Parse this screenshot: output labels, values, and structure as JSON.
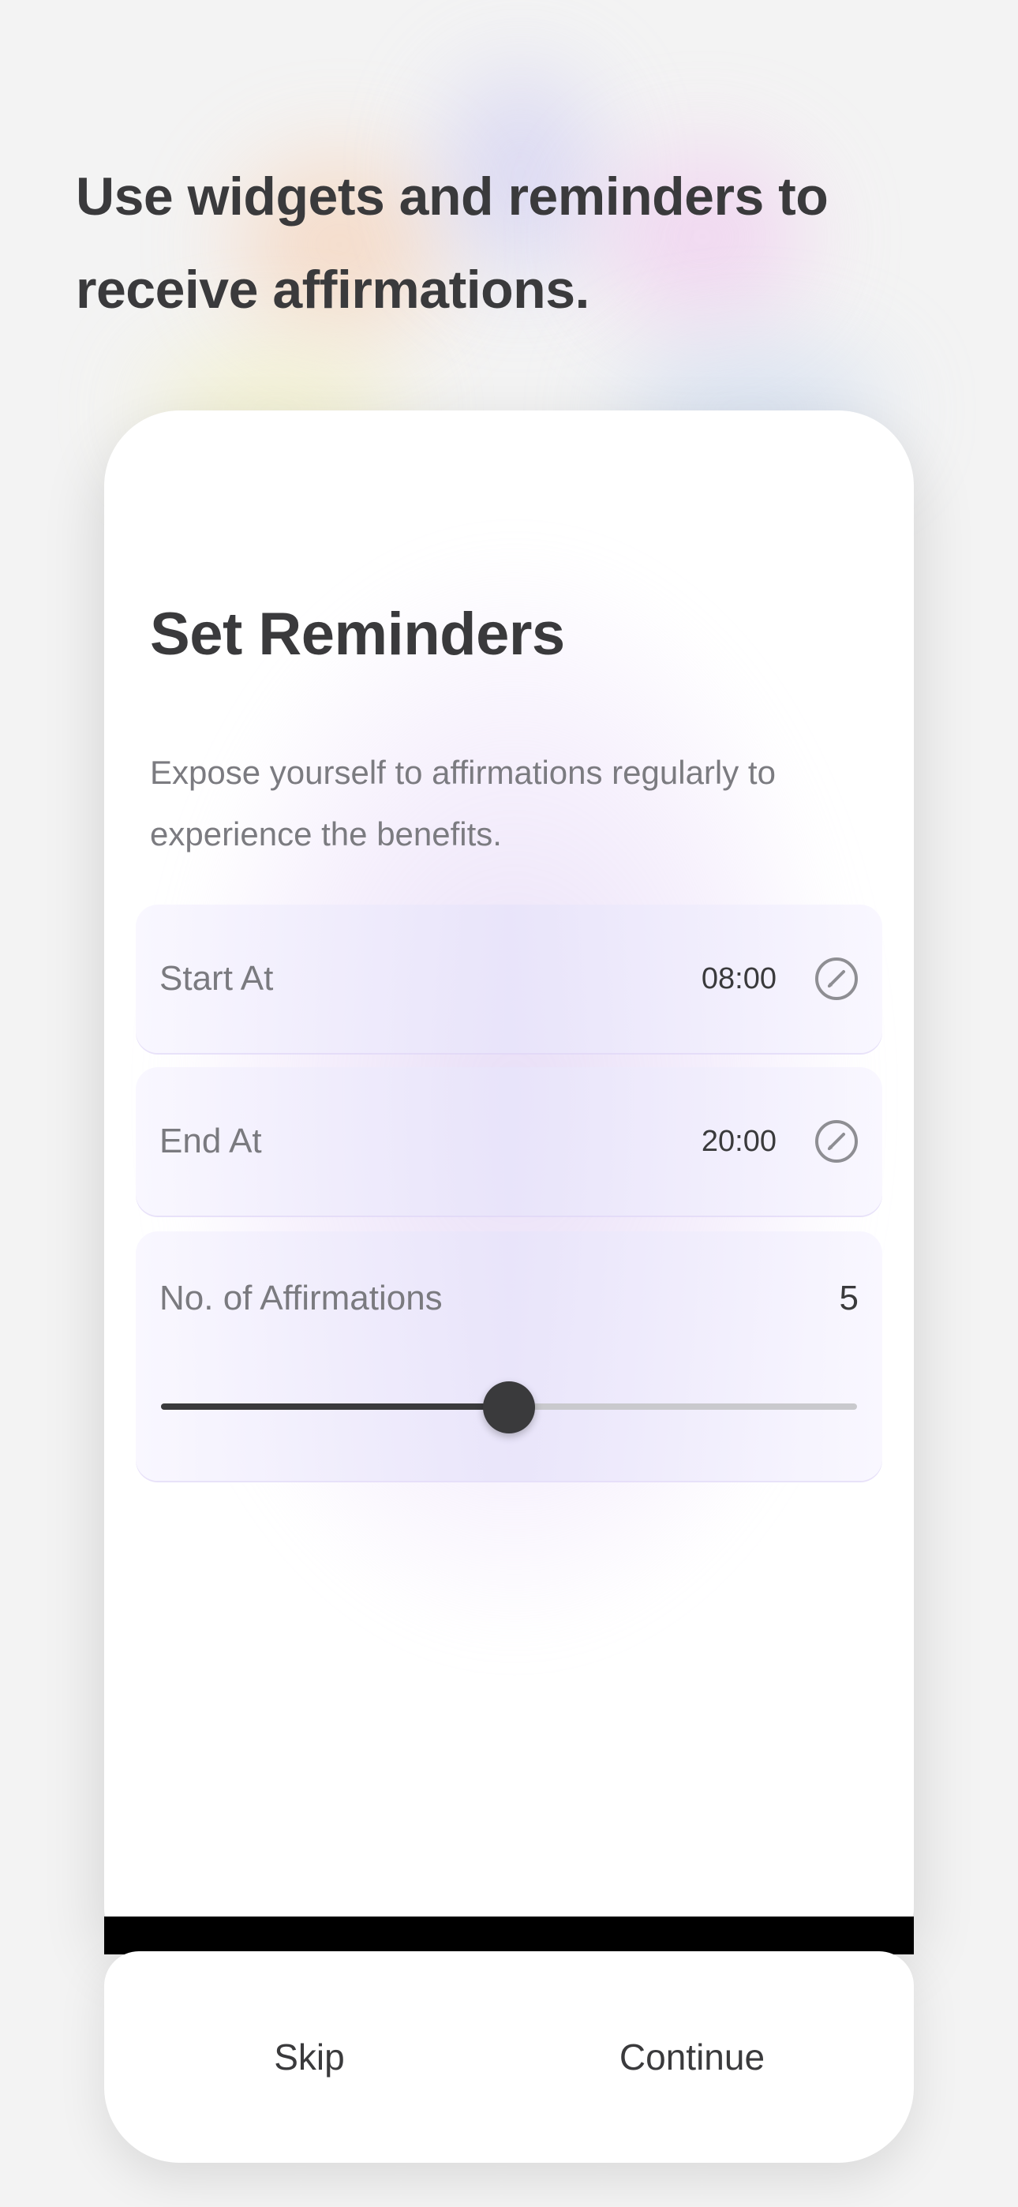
{
  "headline": "Use widgets and reminders to receive affirmations.",
  "card": {
    "title": "Set Reminders",
    "subtitle": "Expose yourself to affirmations regularly to experience the benefits."
  },
  "reminders": {
    "start": {
      "label": "Start At",
      "time": "08:00",
      "icon": "edit-pencil-icon"
    },
    "end": {
      "label": "End At",
      "time": "20:00",
      "icon": "edit-pencil-icon"
    },
    "count": {
      "label": "No. of Affirmations",
      "value": "5",
      "slider_fraction": 0.5
    }
  },
  "footer": {
    "skip_label": "Skip",
    "continue_label": "Continue"
  },
  "colors": {
    "text_dark": "#3a3a3c",
    "text_muted": "#7b7b80",
    "background": "#f3f3f3",
    "card": "#ffffff",
    "slider_active": "#3a3a3c",
    "slider_inactive": "#c9c9cd"
  }
}
